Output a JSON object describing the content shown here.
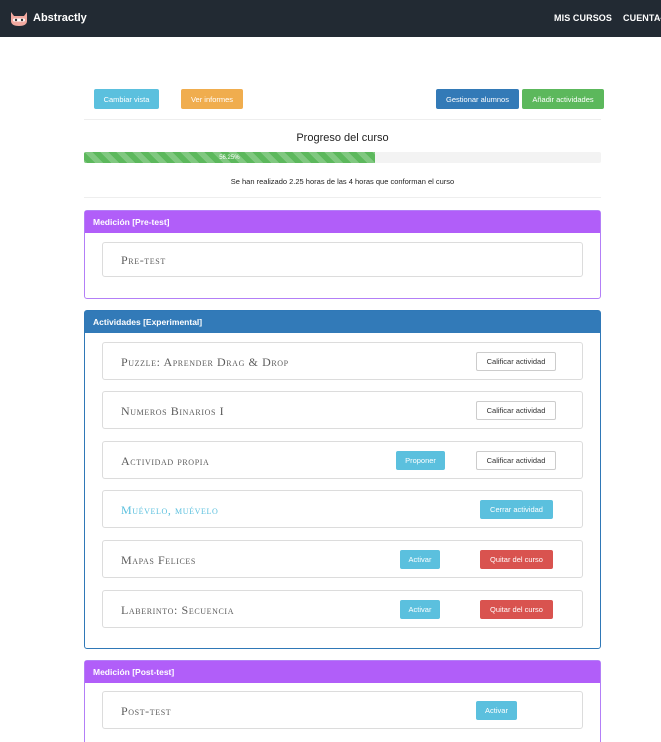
{
  "nav": {
    "brand": "Abstractly",
    "mis_cursos": "MIS CURSOS",
    "cuenta": "CUENTA"
  },
  "toolbar": {
    "cambiar_vista": "Cambiar vista",
    "ver_informes": "Ver informes",
    "gestionar_alumnos": "Gestionar alumnos",
    "anadir_actividades": "Añadir actividades"
  },
  "progress": {
    "title": "Progreso del curso",
    "label": "56.25%",
    "value_percent": 56.25,
    "note": "Se han realizado 2.25 horas de las 4 horas que conforman el curso"
  },
  "sections": {
    "pretest": {
      "heading": "Medición [Pre-test]",
      "items": [
        {
          "title": "Pre-test"
        }
      ]
    },
    "experimental": {
      "heading": "Actividades [Experimental]",
      "items": [
        {
          "title": "Puzzle: Aprender Drag & Drop",
          "button": "Calificar actividad"
        },
        {
          "title": "Numeros Binarios I",
          "button": "Calificar actividad"
        },
        {
          "title": "Actividad propia",
          "button_primary": "Proponer",
          "button": "Calificar actividad"
        },
        {
          "title": "Muévelo, muévelo",
          "button": "Cerrar actividad"
        },
        {
          "title": "Mapas Felices",
          "button_primary": "Activar",
          "button": "Quitar del curso"
        },
        {
          "title": "Laberinto: Secuencia",
          "button_primary": "Activar",
          "button": "Quitar del curso"
        }
      ]
    },
    "posttest": {
      "heading": "Medición [Post-test]",
      "items": [
        {
          "title": "Post-test",
          "button_primary": "Activar"
        }
      ]
    }
  },
  "colors": {
    "navbar": "#222a33",
    "info": "#5bc0de",
    "warning": "#f0ad4e",
    "primary": "#337ab7",
    "success": "#5cb85c",
    "danger": "#d9534f",
    "purple": "#b15ef9"
  }
}
